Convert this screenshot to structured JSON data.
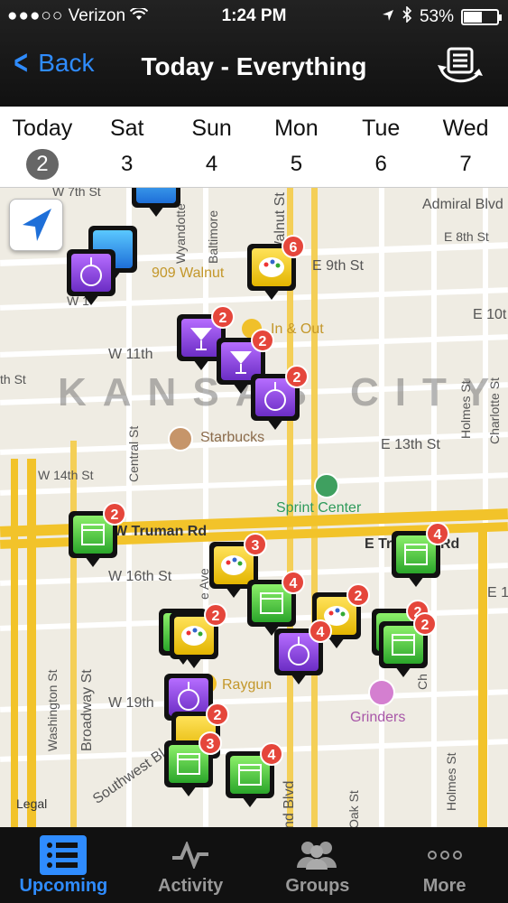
{
  "status": {
    "carrier": "Verizon",
    "signal_dots": "●●●○○",
    "time": "1:24 PM",
    "battery": "53%"
  },
  "nav": {
    "back_label": "Back",
    "title": "Today - Everything"
  },
  "days": [
    {
      "label": "Today",
      "num": "2"
    },
    {
      "label": "Sat",
      "num": "3"
    },
    {
      "label": "Sun",
      "num": "4"
    },
    {
      "label": "Mon",
      "num": "5"
    },
    {
      "label": "Tue",
      "num": "6"
    },
    {
      "label": "Wed",
      "num": "7"
    }
  ],
  "map": {
    "city_label": "KANSAS CITY",
    "streets": {
      "w7th": "W 7th St",
      "admiral": "Admiral Blvd",
      "e8th": "E 8th St",
      "e9th": "E 9th St",
      "e10": "E 10t",
      "w11th": "W 11th",
      "th": "th St",
      "e13th": "E 13th St",
      "w14th": "W 14th St",
      "truman": "W Truman Rd",
      "etr": "E Tr",
      "rd": "Rd",
      "w16th": "W 16th St",
      "e16": "E 16",
      "w19th": "W 19th",
      "wyandotte": "Wyandotte",
      "baltimore": "Baltimore",
      "walnut": "Walnut St",
      "central": "Central St",
      "broadway": "Broadway St",
      "washington": "Washington St",
      "southwest": "Southwest Bl",
      "holmes1": "Holmes St",
      "charlotte": "Charlotte St",
      "holmes2": "Holmes St",
      "oak": "Oak St",
      "grand": "nd Blvd",
      "ave": "e Ave",
      "w1": "W 1",
      "w": "W",
      "ch": "Ch",
      "ch2": "Ch"
    },
    "pois": {
      "walnut909": "909 Walnut",
      "inout": "In & Out",
      "starbucks": "Starbucks",
      "sprint": "Sprint Center",
      "raygun": "Raygun",
      "grinders": "Grinders"
    },
    "legal": "Legal",
    "pins": [
      {
        "type": "blue",
        "badge": ""
      },
      {
        "type": "blue",
        "badge": ""
      },
      {
        "type": "purple",
        "badge": ""
      },
      {
        "type": "yellow",
        "badge": "6"
      },
      {
        "type": "purple",
        "badge": "2"
      },
      {
        "type": "purple",
        "badge": "2"
      },
      {
        "type": "purple",
        "badge": "2"
      },
      {
        "type": "green",
        "badge": "2"
      },
      {
        "type": "green",
        "badge": "4"
      },
      {
        "type": "yellow",
        "badge": "3"
      },
      {
        "type": "green",
        "badge": "4"
      },
      {
        "type": "yellow",
        "badge": "2"
      },
      {
        "type": "green",
        "badge": "2"
      },
      {
        "type": "green",
        "badge": "2"
      },
      {
        "type": "yellow",
        "badge": "2"
      },
      {
        "type": "purple",
        "badge": "4"
      },
      {
        "type": "purple",
        "badge": ""
      },
      {
        "type": "yellow",
        "badge": "2"
      },
      {
        "type": "green",
        "badge": "3"
      },
      {
        "type": "green",
        "badge": "4"
      }
    ]
  },
  "tabs": [
    {
      "label": "Upcoming",
      "icon": "list-icon"
    },
    {
      "label": "Activity",
      "icon": "pulse-icon"
    },
    {
      "label": "Groups",
      "icon": "people-icon"
    },
    {
      "label": "More",
      "icon": "more-icon"
    }
  ],
  "colors": {
    "accent": "#2f8cff",
    "badge": "#e5463b",
    "highway": "#f2c32a"
  }
}
